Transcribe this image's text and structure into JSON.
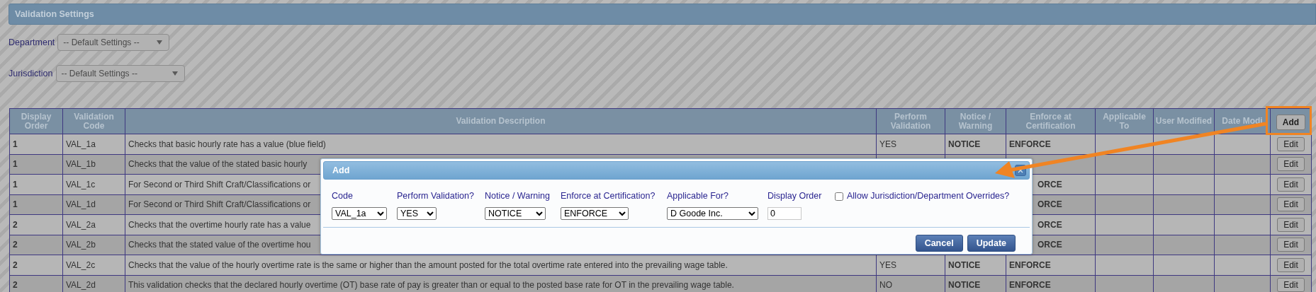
{
  "header": {
    "title": "Validation Settings"
  },
  "filters": [
    {
      "label": "Department",
      "value": "-- Default Settings --"
    },
    {
      "label": "Jurisdiction",
      "value": "-- Default Settings --"
    }
  ],
  "table": {
    "columns": [
      "Display Order",
      "Validation Code",
      "Validation Description",
      "Perform Validation",
      "Notice / Warning",
      "Enforce at Certification",
      "Applicable To",
      "User Modified",
      "Date Modi"
    ],
    "add_button": "Add",
    "rows": [
      {
        "order": "1",
        "code": "VAL_1a",
        "description": "Checks that basic hourly rate has a value (blue field)",
        "perform": "YES",
        "notice": "NOTICE",
        "enforce": "ENFORCE",
        "action": "Edit"
      },
      {
        "order": "1",
        "code": "VAL_1b",
        "description": "Checks that the value of the stated basic hourly",
        "action": "Edit"
      },
      {
        "order": "1",
        "code": "VAL_1c",
        "description": "For Second or Third Shift Craft/Classifications or",
        "enforce": "ORCE",
        "action": "Edit"
      },
      {
        "order": "1",
        "code": "VAL_1d",
        "description": "For Second or Third Shift Craft/Classifications or",
        "enforce": "ORCE",
        "action": "Edit"
      },
      {
        "order": "2",
        "code": "VAL_2a",
        "description": "Checks that the overtime hourly rate has a value",
        "enforce": "ORCE",
        "action": "Edit"
      },
      {
        "order": "2",
        "code": "VAL_2b",
        "description": "Checks that the stated value of the overtime hou",
        "enforce": "ORCE",
        "action": "Edit"
      },
      {
        "order": "2",
        "code": "VAL_2c",
        "description": "Checks that the value of the hourly overtime rate is the same or higher than the amount posted for the total overtime rate entered into the prevailing wage table.",
        "perform": "YES",
        "notice": "NOTICE",
        "enforce": "ENFORCE",
        "action": "Edit"
      },
      {
        "order": "2",
        "code": "VAL_2d",
        "description": "This validation checks that the declared hourly overtime (OT) base rate of pay is greater than or equal to the posted base rate for OT in the prevailing wage table.",
        "perform": "NO",
        "notice": "NOTICE",
        "enforce": "ENFORCE",
        "action": "Edit"
      }
    ]
  },
  "dialog": {
    "title": "Add",
    "fields": [
      {
        "kind": "select",
        "label": "Code",
        "value": "VAL_1a"
      },
      {
        "kind": "select",
        "label": "Perform Validation?",
        "value": "YES"
      },
      {
        "kind": "select",
        "label": "Notice / Warning",
        "value": "NOTICE"
      },
      {
        "kind": "select",
        "label": "Enforce at Certification?",
        "value": "ENFORCE"
      },
      {
        "kind": "select",
        "label": "Applicable For?",
        "value": "D Goode Inc."
      },
      {
        "kind": "input",
        "label": "Display Order",
        "value": "0"
      },
      {
        "kind": "checkbox",
        "label": "Allow Jurisdiction/Department Overrides?",
        "checked": false
      }
    ],
    "buttons": [
      "Cancel",
      "Update"
    ]
  }
}
